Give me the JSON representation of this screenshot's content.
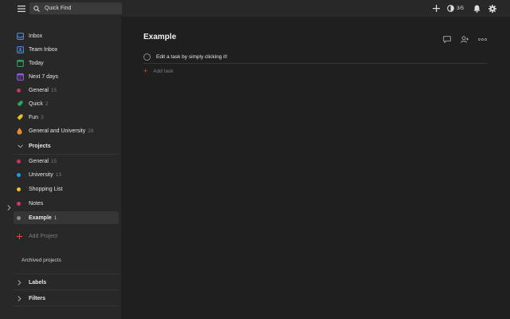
{
  "colors": {
    "accent": "#dd4b39",
    "inbox": "#4a8ad8",
    "team_inbox": "#4a8ad8",
    "today": "#2e9b5f",
    "next7": "#8a5bd4"
  },
  "search": {
    "placeholder": "Quick Find"
  },
  "top": {
    "karma": "3/5"
  },
  "nav": [
    {
      "label": "Inbox",
      "count": "",
      "icon": "inbox-icon"
    },
    {
      "label": "Team Inbox",
      "count": "",
      "icon": "team-inbox-icon"
    },
    {
      "label": "Today",
      "count": "",
      "icon": "calendar-today-icon"
    },
    {
      "label": "Next 7 days",
      "count": "",
      "icon": "calendar-week-icon"
    }
  ],
  "filters_list": [
    {
      "label": "General",
      "count": "15",
      "color": "#c7375a",
      "icon": "circle-dot"
    },
    {
      "label": "Quick",
      "count": "2",
      "color": "#29a65a",
      "icon": "tag-icon"
    },
    {
      "label": "Fun",
      "count": "3",
      "color": "#e4c21b",
      "icon": "tag-icon"
    },
    {
      "label": "General and University",
      "count": "28",
      "color": "#e98a2f",
      "icon": "drop-icon"
    }
  ],
  "projects_header": "Projects",
  "projects": [
    {
      "label": "General",
      "count": "15",
      "color": "#c7375a"
    },
    {
      "label": "University",
      "count": "13",
      "color": "#1b9ed8"
    },
    {
      "label": "Shopping List",
      "count": "",
      "color": "#f0c22a"
    },
    {
      "label": "Notes",
      "count": "",
      "color": "#d6366b"
    },
    {
      "label": "Example",
      "count": "1",
      "color": "#8a8a8a"
    }
  ],
  "add_project": "Add Project",
  "archived": "Archived projects",
  "labels_header": "Labels",
  "filters_header": "Filters",
  "main": {
    "title": "Example",
    "task": "Edit a task by simply clicking it!",
    "add_task": "Add task"
  }
}
